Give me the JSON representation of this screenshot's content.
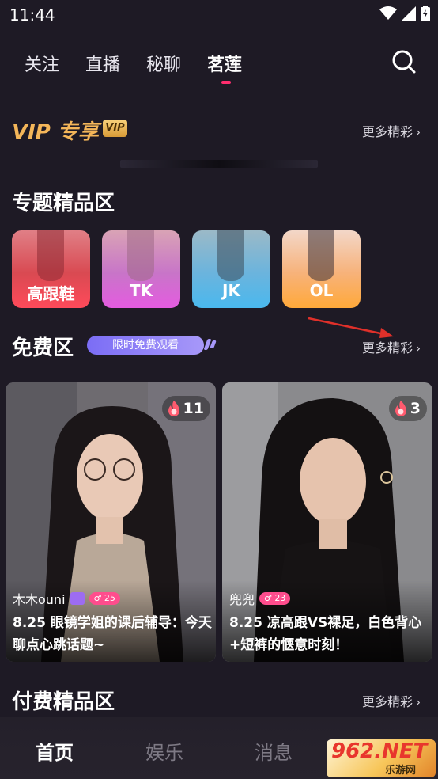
{
  "status_bar": {
    "time": "11:44",
    "icons": [
      "wifi-icon",
      "signal-icon",
      "battery-icon"
    ]
  },
  "top_nav": {
    "tabs": [
      {
        "label": "关注",
        "active": false
      },
      {
        "label": "直播",
        "active": false
      },
      {
        "label": "秘聊",
        "active": false
      },
      {
        "label": "茗莲",
        "active": true
      }
    ],
    "search_icon": "search-icon",
    "accent_color": "#ff2d6e"
  },
  "vip_section": {
    "title": "VIP 专享",
    "badge": "VIP",
    "more_label": "更多精彩"
  },
  "topics_section": {
    "title": "专题精品区",
    "items": [
      {
        "label": "高跟鞋",
        "color": "#ff4a5a"
      },
      {
        "label": "TK",
        "color": "#e45be0"
      },
      {
        "label": "JK",
        "color": "#4ab8ee"
      },
      {
        "label": "OL",
        "color": "#ffa93a"
      }
    ]
  },
  "free_section": {
    "title": "免费区",
    "pill": "限时免费观看",
    "more_label": "更多精彩",
    "cards": [
      {
        "heat": "11",
        "author": "木木ouni",
        "level": "25",
        "title_line1": "8.25 眼镜学姐的课后辅导：今天",
        "title_line2": "聊点心跳话题~"
      },
      {
        "heat": "3",
        "author": "兜兜",
        "level": "23",
        "title_line1": "8.25 凉高跟VS裸足，白色背心",
        "title_line2": "+短裤的惬意时刻！"
      }
    ]
  },
  "paid_section": {
    "title": "付费精品区",
    "more_label": "更多精彩"
  },
  "bottom_nav": {
    "items": [
      {
        "label": "首页",
        "active": true
      },
      {
        "label": "娱乐",
        "active": false
      },
      {
        "label": "消息",
        "active": false
      }
    ]
  },
  "watermark": {
    "big": "962.NET",
    "small": "乐游网"
  }
}
